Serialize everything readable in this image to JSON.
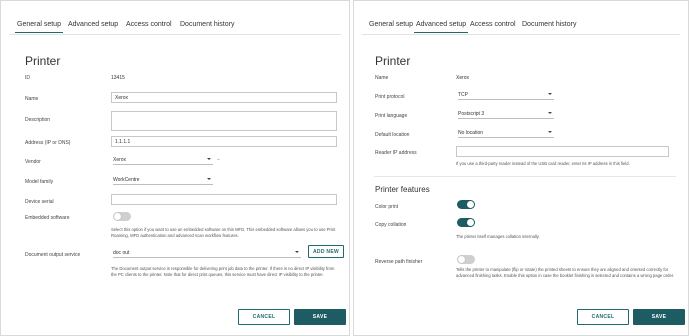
{
  "left": {
    "tabs": [
      {
        "label": "General setup",
        "active": true
      },
      {
        "label": "Advanced setup",
        "active": false
      },
      {
        "label": "Access control",
        "active": false
      },
      {
        "label": "Document history",
        "active": false
      }
    ],
    "title": "Printer",
    "id_label": "ID",
    "id_value": "13415",
    "name_label": "Name",
    "name_value": "Xerox",
    "description_label": "Description",
    "description_value": "",
    "address_label": "Address (IP or DNS)",
    "address_value": "1.1.1.1",
    "vendor_label": "Vendor",
    "vendor_value": "Xerox",
    "vendor_suffix": "–",
    "model_label": "Model family",
    "model_value": "WorkCentre",
    "serial_label": "Device serial",
    "serial_value": "",
    "embedded_label": "Embedded software",
    "embedded_on": false,
    "embedded_help": "Select this option if you want to use an embedded software on this MFD. This embedded software allows you to use Print Roaming, MFD authentication and advanced scan workflow features.",
    "dos_label": "Document output service",
    "dos_value": "doc out",
    "add_new_label": "ADD NEW",
    "dos_help": "The Document output service is responsible for delivering print job data to the printer. If there is no direct IP visibility from the PC clients to the printer. Note that for direct print queues, this service must have direct IP visibility to the printer.",
    "cancel_label": "CANCEL",
    "save_label": "SAVE"
  },
  "right": {
    "tabs": [
      {
        "label": "General setup",
        "active": false
      },
      {
        "label": "Advanced setup",
        "active": true
      },
      {
        "label": "Access control",
        "active": false
      },
      {
        "label": "Document history",
        "active": false
      }
    ],
    "title": "Printer",
    "name_label": "Name",
    "name_value": "Xerox",
    "protocol_label": "Print protocol",
    "protocol_value": "TCP",
    "language_label": "Print language",
    "language_value": "Postscript 3",
    "location_label": "Default location",
    "location_value": "No location",
    "reader_label": "Reader IP address",
    "reader_value": "",
    "reader_help": "If you use a third-party reader instead of the USB card reader, enter its IP address in this field.",
    "features_title": "Printer features",
    "color_label": "Color print",
    "color_on": true,
    "collation_label": "Copy collation",
    "collation_on": true,
    "collation_help": "The printer itself manages collation internally.",
    "reverse_label": "Reverse path finisher",
    "reverse_on": false,
    "reverse_help": "Tells the printer to manipulate (flip or rotate) the printed sheets to ensure they are aligned and oriented correctly for advanced finishing tasks. Enable this option in case the booklet finishing is selected and contains a wrong page order.",
    "cancel_label": "CANCEL",
    "save_label": "SAVE"
  },
  "colors": {
    "accent": "#1e5c63",
    "toggle_off": "#cfcfcf",
    "border": "#c8c8c8"
  }
}
